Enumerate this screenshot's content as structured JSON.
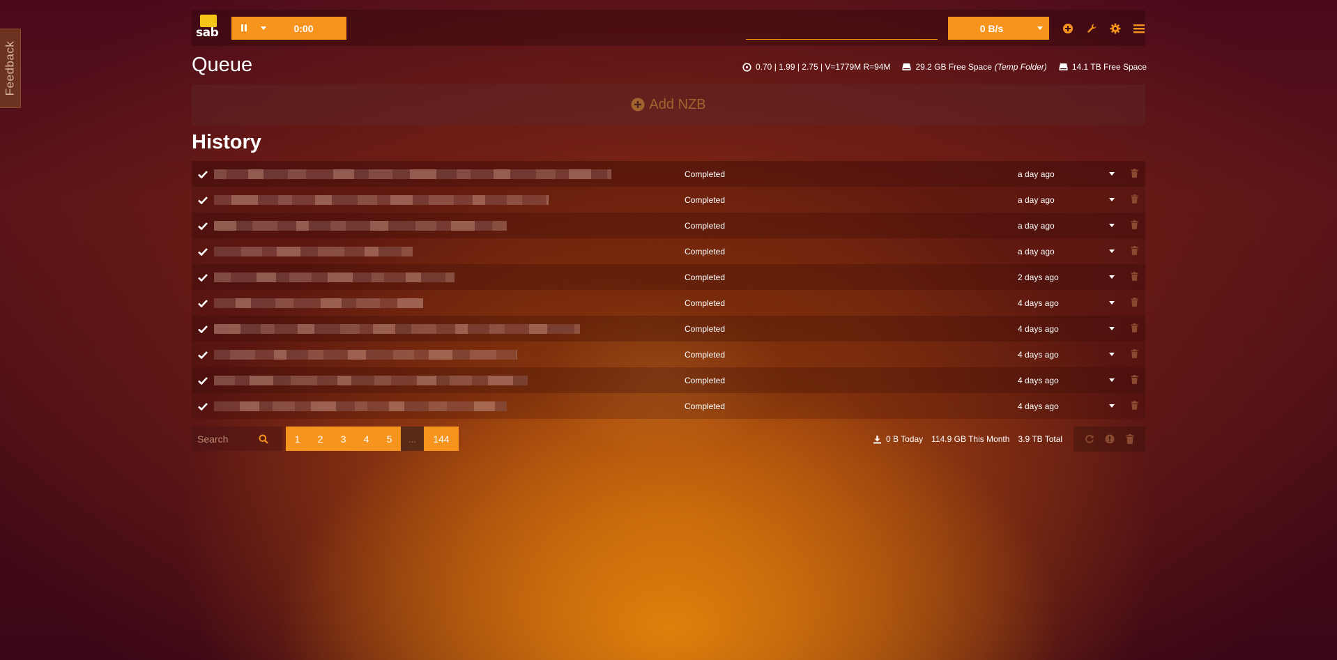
{
  "feedback": {
    "label": "Feedback"
  },
  "navbar": {
    "logo_text": "sab",
    "timer": "0:00",
    "speed_limit_placeholder": "",
    "speed": "0 B/s"
  },
  "queue": {
    "title": "Queue",
    "load": "0.70 | 1.99 | 2.75 | V=1779M R=94M",
    "temp_free": "29.2 GB Free Space",
    "temp_label": "(Temp Folder)",
    "free": "14.1 TB Free Space",
    "add_nzb": "Add NZB"
  },
  "history": {
    "title": "History",
    "rows": [
      {
        "status": "Completed",
        "age": "a day ago"
      },
      {
        "status": "Completed",
        "age": "a day ago"
      },
      {
        "status": "Completed",
        "age": "a day ago"
      },
      {
        "status": "Completed",
        "age": "a day ago"
      },
      {
        "status": "Completed",
        "age": "2 days ago"
      },
      {
        "status": "Completed",
        "age": "4 days ago"
      },
      {
        "status": "Completed",
        "age": "4 days ago"
      },
      {
        "status": "Completed",
        "age": "4 days ago"
      },
      {
        "status": "Completed",
        "age": "4 days ago"
      },
      {
        "status": "Completed",
        "age": "4 days ago"
      }
    ]
  },
  "bottom": {
    "search_placeholder": "Search",
    "pages": [
      "1",
      "2",
      "3",
      "4",
      "5",
      "...",
      "144"
    ],
    "today": "0 B Today",
    "month": "114.9 GB This Month",
    "total": "3.9 TB Total"
  },
  "colors": {
    "accent": "#f7941d",
    "text": "#ffffff"
  },
  "icons": [
    "pause-icon",
    "chevron-down-icon",
    "plus-circle-icon",
    "wrench-icon",
    "gear-icon",
    "menu-icon",
    "dashboard-icon",
    "hdd-icon",
    "check-icon",
    "trash-icon",
    "search-icon",
    "download-icon",
    "refresh-icon",
    "info-icon"
  ]
}
